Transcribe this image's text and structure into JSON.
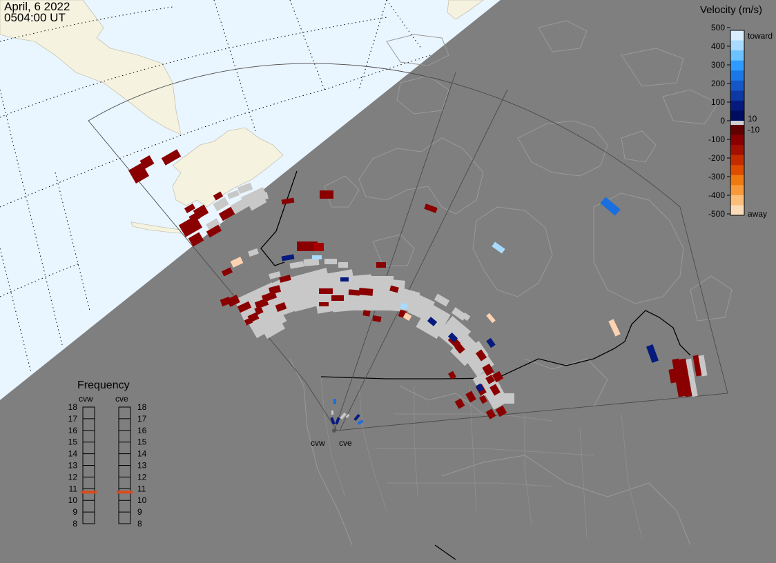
{
  "header": {
    "date": "April, 6 2022",
    "time": "0504:00 UT"
  },
  "velocity_scale": {
    "title": "Velocity (m/s)",
    "ticks": [
      "500",
      "400",
      "300",
      "200",
      "100",
      "0",
      "-100",
      "-200",
      "-300",
      "-400",
      "-500"
    ],
    "side_labels": {
      "toward": "toward",
      "pos10": "10",
      "neg10": "-10",
      "away": "away"
    },
    "colors_toward": [
      "#d8eeff",
      "#a9daff",
      "#6cc2ff",
      "#2f9bff",
      "#1a78e6",
      "#1657c8",
      "#0e39a4",
      "#061a7e",
      "#000c60"
    ],
    "colors_away": [
      "#600000",
      "#8a0000",
      "#a41000",
      "#c42c00",
      "#dc4d00",
      "#ee7a10",
      "#f89a3a",
      "#fbbf7a",
      "#fcdcb8"
    ],
    "zero_color": "#d0d0d0"
  },
  "frequency": {
    "title": "Frequency",
    "radars": [
      "cvw",
      "cve"
    ],
    "levels": [
      "18",
      "17",
      "16",
      "15",
      "14",
      "13",
      "12",
      "11",
      "10",
      "9",
      "8"
    ],
    "selected": {
      "cvw": 10.7,
      "cve": 10.7
    },
    "marker_color": "#dd4a1a"
  },
  "map": {
    "radar_labels": [
      "cvw",
      "cve"
    ],
    "colors": {
      "ocean": "#e9f5ff",
      "land_lit": "#f5f2e0",
      "night": "#7f7f7f",
      "coast": "#9a9a9a",
      "fov": "#5a5a5a",
      "grid": "#000000",
      "gray_scatter": "#c8c8c8"
    }
  }
}
